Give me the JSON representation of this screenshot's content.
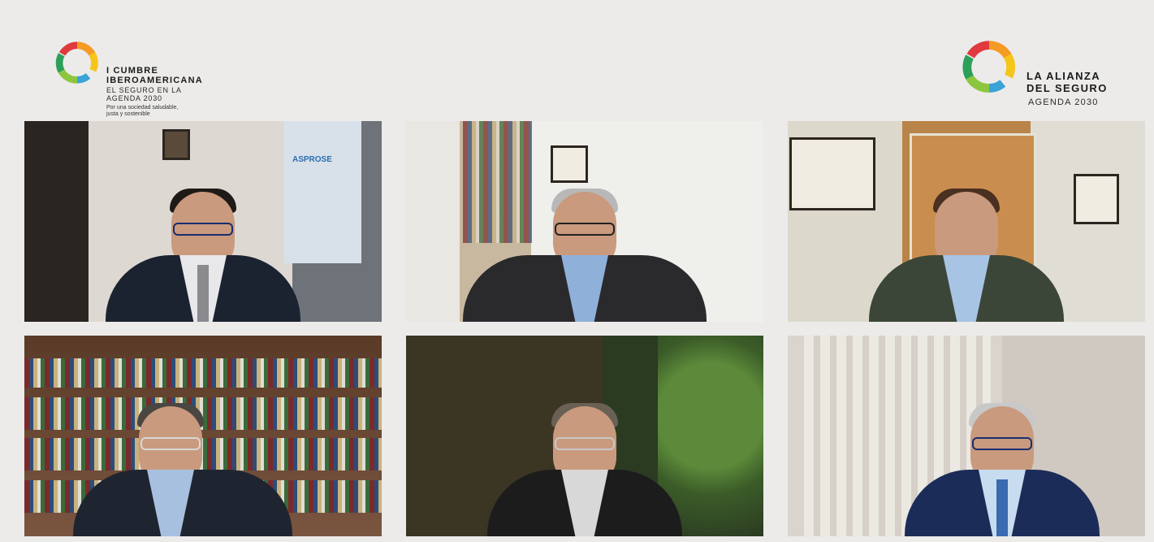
{
  "event_logo": {
    "line1": "I CUMBRE",
    "line2": "IBEROAMERICANA",
    "sub1": "EL SEGURO EN LA",
    "sub2": "AGENDA 2030",
    "small1": "Por una sociedad saludable,",
    "small2": "justa y sostenible"
  },
  "alliance_logo": {
    "line1": "LA ALIANZA",
    "line2": "DEL SEGURO",
    "sub": "AGENDA 2030"
  },
  "tiles": [
    {
      "id": 1,
      "sign": "ASPROSE"
    },
    {
      "id": 2
    },
    {
      "id": 3
    },
    {
      "id": 4
    },
    {
      "id": 5
    },
    {
      "id": 6
    }
  ],
  "colors": {
    "background": "#ecebea",
    "ring": [
      "#e03a3e",
      "#f59a23",
      "#f5c518",
      "#8cc63f",
      "#3aa3d8",
      "#2a6db0"
    ]
  }
}
